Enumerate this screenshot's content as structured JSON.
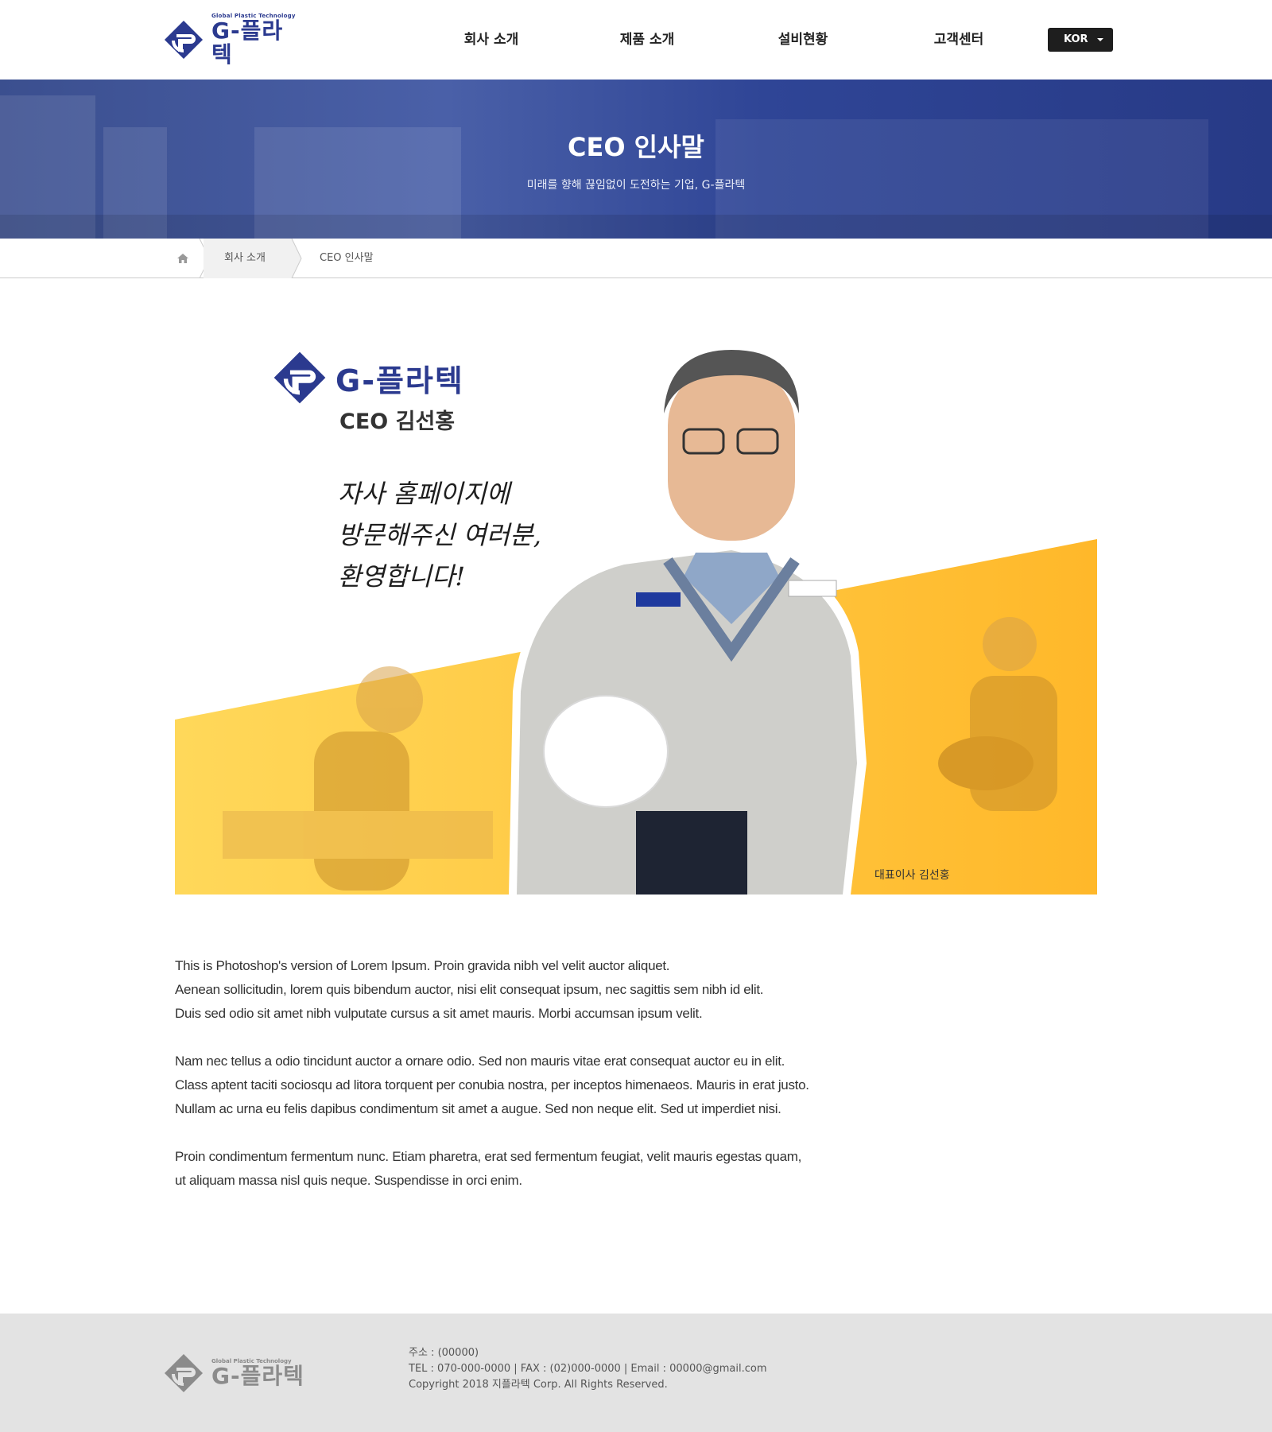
{
  "header": {
    "logo_tagline": "Global Plastic Technology",
    "logo_brand": "G-플라텍",
    "nav": [
      "회사 소개",
      "제품 소개",
      "설비현황",
      "고객센터"
    ],
    "language": "KOR"
  },
  "hero": {
    "title": "CEO 인사말",
    "subtitle": "미래를 향해 끊임없이 도전하는 기업, G-플라텍"
  },
  "breadcrumb": {
    "home_icon": "home-icon",
    "items": [
      "회사 소개",
      "CEO 인사말"
    ]
  },
  "visual": {
    "brand": "G-플라텍",
    "ceo_name": "CEO 김선홍",
    "greeting_lines": [
      "자사 홈페이지에",
      "방문해주신 여러분,",
      "환영합니다!"
    ],
    "caption": "대표이사 김선홍",
    "accent_color": "#ffc93c",
    "brand_color": "#2b3a8f"
  },
  "body": {
    "paragraphs": [
      [
        "This is Photoshop's version  of Lorem Ipsum. Proin gravida nibh vel velit auctor aliquet.",
        "Aenean sollicitudin, lorem quis bibendum auctor, nisi elit consequat ipsum, nec sagittis sem nibh id elit.",
        "Duis sed odio sit amet nibh vulputate cursus a sit amet mauris. Morbi accumsan ipsum velit."
      ],
      [
        "Nam nec tellus a odio tincidunt auctor a ornare odio. Sed non  mauris vitae erat consequat auctor eu in elit.",
        "Class aptent taciti sociosqu ad litora torquent per conubia nostra, per inceptos himenaeos. Mauris in erat justo.",
        "Nullam ac urna eu felis dapibus condimentum sit amet a augue. Sed non neque elit. Sed ut imperdiet nisi."
      ],
      [
        "Proin condimentum fermentum nunc. Etiam pharetra, erat sed fermentum feugiat, velit mauris egestas quam,",
        "ut aliquam massa nisl quis neque. Suspendisse in orci enim."
      ]
    ]
  },
  "footer": {
    "logo_tagline": "Global Plastic Technology",
    "logo_brand": "G-플라텍",
    "address": "주소 : (00000)",
    "contact": "TEL : 070-000-0000  |  FAX : (02)000-0000  |  Email : 00000@gmail.com",
    "copyright": "Copyright 2018 지플라텍 Corp. All Rights Reserved."
  }
}
